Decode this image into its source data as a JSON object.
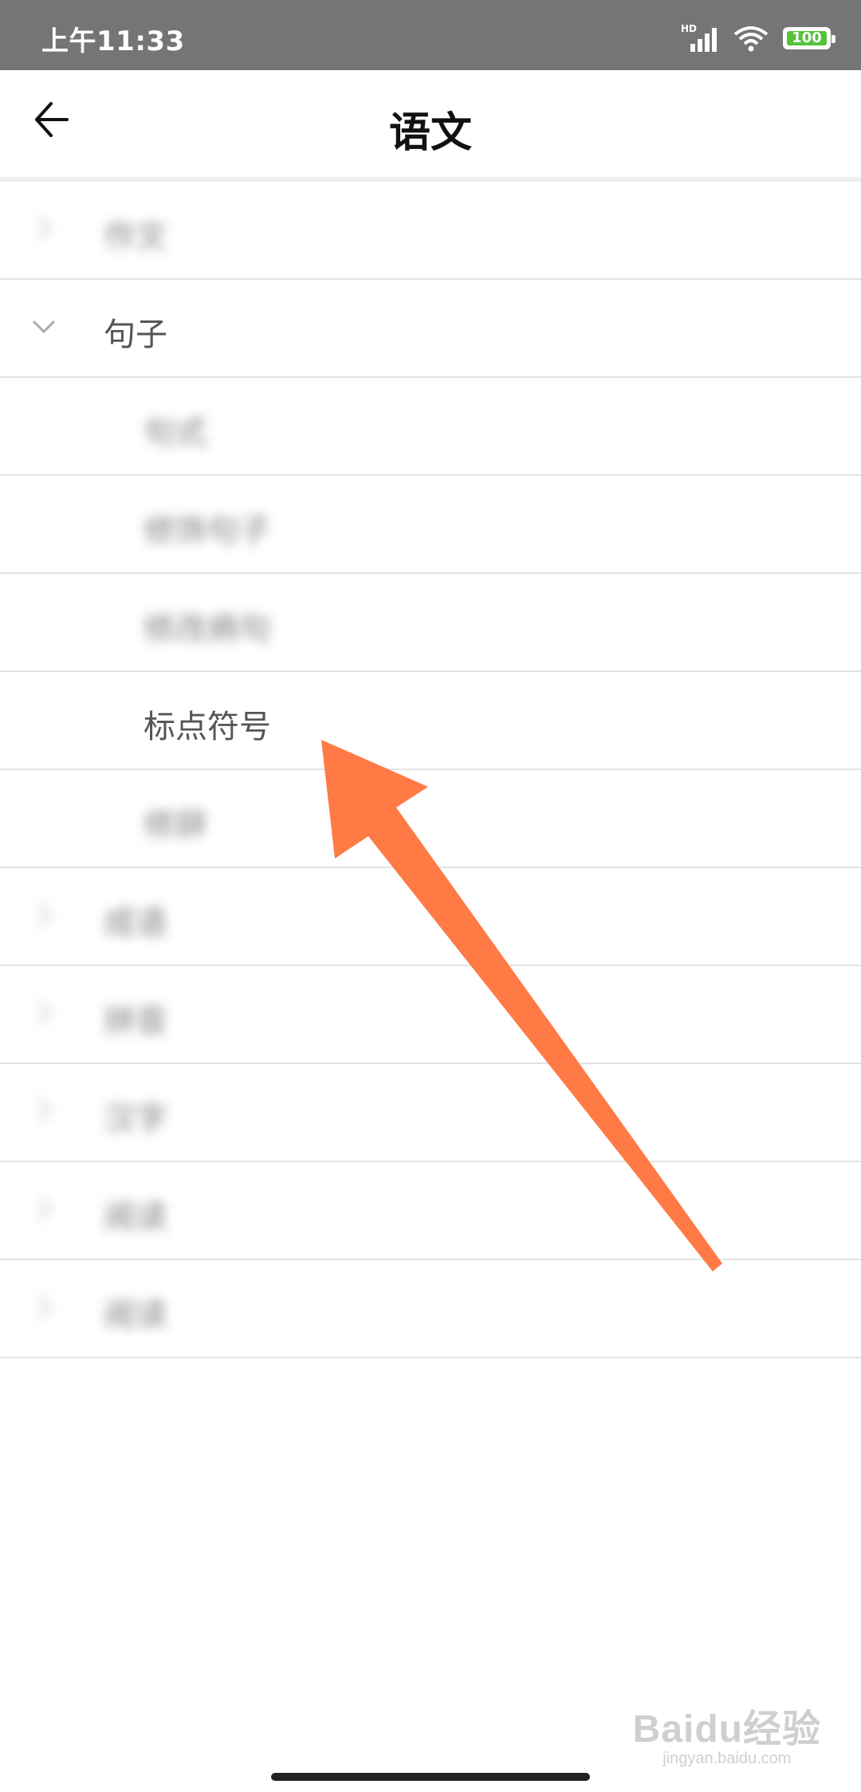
{
  "status_bar": {
    "time": "上午11:33",
    "network_label": "HD",
    "battery_level": "100",
    "battery_color": "#55c23a"
  },
  "header": {
    "title": "语文",
    "back_icon": "arrow-left-icon"
  },
  "list": {
    "items": [
      {
        "label": "作文",
        "level": 0,
        "expanded": false,
        "blurred": true
      },
      {
        "label": "句子",
        "level": 0,
        "expanded": true,
        "blurred": false
      },
      {
        "label": "句式",
        "level": 1,
        "blurred": true
      },
      {
        "label": "修饰句子",
        "level": 1,
        "blurred": true
      },
      {
        "label": "修改病句",
        "level": 1,
        "blurred": true
      },
      {
        "label": "标点符号",
        "level": 1,
        "blurred": false
      },
      {
        "label": "修辞",
        "level": 1,
        "blurred": true
      },
      {
        "label": "成语",
        "level": 0,
        "expanded": false,
        "blurred": true
      },
      {
        "label": "拼音",
        "level": 0,
        "expanded": false,
        "blurred": true
      },
      {
        "label": "汉字",
        "level": 0,
        "expanded": false,
        "blurred": true
      },
      {
        "label": "阅读",
        "level": 0,
        "expanded": false,
        "blurred": true
      },
      {
        "label": "阅读",
        "level": 0,
        "expanded": false,
        "blurred": true
      }
    ]
  },
  "annotation": {
    "arrow_color": "#ff7a45"
  },
  "watermark": {
    "main": "Baidu经验",
    "sub": "jingyan.baidu.com"
  }
}
